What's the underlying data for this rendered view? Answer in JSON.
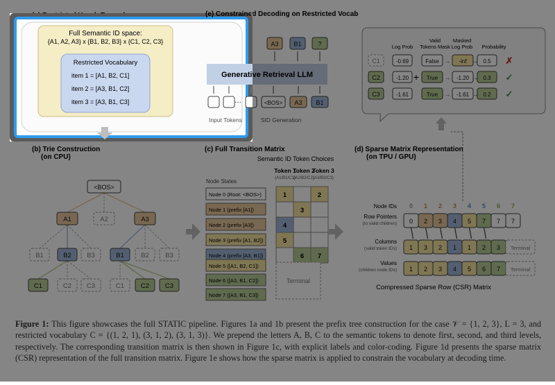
{
  "panels": {
    "a": {
      "label": "(a) Restricted Vocab Example",
      "space_title": "Full Semantic ID space:",
      "space_formula": "{A1, A2, A3} x {B1, B2, B3} x {C1, C2, C3}",
      "vocab_title": "Restricted Vocabulary",
      "items": [
        "item 1 = [A1, B2, C1]",
        "item 2 = [A3, B1, C2]",
        "item 3 = [A3, B1, C3]"
      ]
    },
    "b": {
      "label": "(b) Trie Construction",
      "sublabel": "(on CPU)",
      "root": "<BOS>",
      "level1": [
        "A1",
        "A2",
        "A3"
      ],
      "level2": [
        "B1",
        "B2",
        "B3",
        "B1",
        "B2",
        "B3"
      ],
      "level3": [
        "C1",
        "C2",
        "C3",
        "C1",
        "C2",
        "C3"
      ]
    },
    "c": {
      "label": "(c) Full Transition Matrix",
      "choices_title": "Semantic ID Token Choices",
      "node_states_title": "Node States",
      "tokens": [
        {
          "name": "Token 1",
          "sub": "(A1/B1/C1)"
        },
        {
          "name": "Token 2",
          "sub": "(A2/B2/C2)"
        },
        {
          "name": "Token 3",
          "sub": "(A3/B3/C3)"
        }
      ],
      "nodes": [
        "Node 0 (Root: <BOS>)",
        "Node 1 (prefix [A1])",
        "Node 2 (prefix [A3])",
        "Node 3 (prefix [A1, B2])",
        "Node 4 (prefix [A3, B1])",
        "Node 5 ([A1, B2, C1])",
        "Node 6 ([A3, B1, C2])",
        "Node 7 ([A3, B1, C3])"
      ],
      "cells": [
        [
          "1",
          "",
          "2"
        ],
        [
          "",
          "3",
          ""
        ],
        [
          "4",
          "",
          ""
        ],
        [
          "5",
          "",
          ""
        ],
        [
          "",
          "6",
          "7"
        ]
      ],
      "terminal": "Terminal"
    },
    "d": {
      "label": "(d) Sparse Matrix Representation",
      "sublabel": "(on TPU / GPU)",
      "node_ids_label": "Node IDs",
      "node_ids": [
        "0",
        "1",
        "2",
        "3",
        "4",
        "5",
        "6",
        "7"
      ],
      "row_pointers_label": "Row Pointers",
      "row_pointers_sub": "(to valid children)",
      "row_pointers": [
        "0",
        "2",
        "3",
        "4",
        "5",
        "7",
        "7",
        "7"
      ],
      "columns_label": "Columns",
      "columns_sub": "(valid token IDs)",
      "columns": [
        "1",
        "3",
        "2",
        "1",
        "1",
        "2",
        "3"
      ],
      "values_label": "Values",
      "values_sub": "(children node IDs)",
      "values": [
        "1",
        "2",
        "3",
        "4",
        "5",
        "6",
        "7"
      ],
      "terminal": "Terminal",
      "footer": "Compressed Sparse Row (CSR) Matrix"
    },
    "e": {
      "label": "(e) Constrained Decoding on Restricted Vocab",
      "llm": "Generative Retrieval LLM",
      "outputs": [
        "A3",
        "B1",
        "?"
      ],
      "inputs_label": "Input Tokens",
      "dots": "···",
      "bos": "<BOS>",
      "sid_tokens": [
        "A3",
        "B1"
      ],
      "sid_label": "SID Generation",
      "headers": [
        "Log Prob",
        "Valid Tokens Mask",
        "Masked Log Prob",
        "Probability"
      ],
      "rows": [
        {
          "token": "C1",
          "logp": "-0.69",
          "mask": "False",
          "masked": "-inf",
          "prob": "0.5",
          "mark": "✗"
        },
        {
          "token": "C2",
          "logp": "-1.20",
          "mask": "True",
          "masked": "-1.20",
          "prob": "0.3",
          "mark": "✓"
        },
        {
          "token": "C3",
          "logp": "-1.61",
          "mask": "True",
          "masked": "-1.61",
          "prob": "0.2",
          "mark": "✓"
        }
      ],
      "plus": "+",
      "arrow": "→"
    }
  },
  "caption": {
    "lines": [
      "This figure showcases the full STATIC pipeline. Figures 1a and 1b present the prefix tree construction for the case",
      "𝒱 = {1, 2, 3}, L = 3, and restricted vocabulary C = {(1, 2, 1), (3, 1, 2), (3, 1, 3)}. We prepend the letters A, B, C to the semantic tokens",
      "to denote first, second, and third levels, respectively. The corresponding transition matrix is then shown in Figure 1c, with",
      "explicit labels and color-coding. Figure 1d presents the sparse matrix (CSR) representation of the full transition matrix. Figure",
      "1e shows how the sparse matrix is applied to constrain the vocabulary at decoding time."
    ],
    "prefix": "Figure 1:"
  },
  "colors": {
    "a_level": "#e9c79c",
    "b_level": "#9fb6d6",
    "c_level": "#b9cc96",
    "ext": "#f3e2a0",
    "highlight": "#2f9bee"
  }
}
